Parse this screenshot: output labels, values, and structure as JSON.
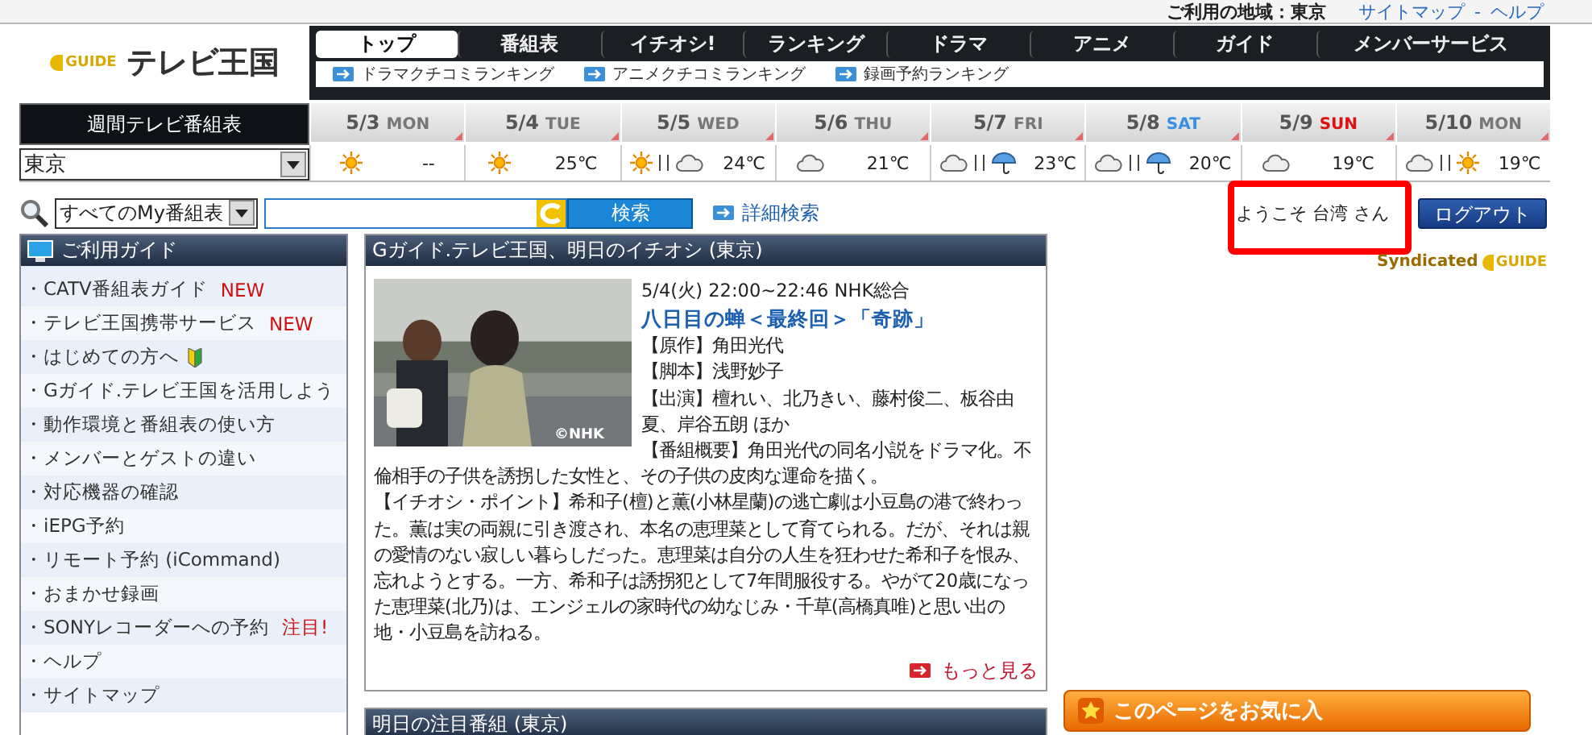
{
  "top_bar": {
    "region_label": "ご利用の地域：東京",
    "links": [
      "サイトマップ",
      "ヘルプ"
    ],
    "link_separator": "-"
  },
  "logo": {
    "badge": "GUIDE",
    "title": "テレビ王国"
  },
  "nav": {
    "tabs": [
      {
        "label": "トップ",
        "selected": true
      },
      {
        "label": "番組表",
        "selected": false
      },
      {
        "label": "イチオシ!",
        "selected": false
      },
      {
        "label": "ランキング",
        "selected": false
      },
      {
        "label": "ドラマ",
        "selected": false
      },
      {
        "label": "アニメ",
        "selected": false
      },
      {
        "label": "ガイド",
        "selected": false
      },
      {
        "label": "メンバーサービス",
        "selected": false
      }
    ],
    "sub_links": [
      "ドラマクチコミランキング",
      "アニメクチコミランキング",
      "録画予約ランキング"
    ]
  },
  "week": {
    "title": "週間テレビ番組表",
    "region": "東京",
    "days": [
      {
        "date": "5/3",
        "weekday": "MON",
        "color": "#777777",
        "weather": [
          {
            "kind": "sun"
          }
        ],
        "temp": "--"
      },
      {
        "date": "5/4",
        "weekday": "TUE",
        "color": "#777777",
        "weather": [
          {
            "kind": "sun"
          }
        ],
        "temp": "25℃"
      },
      {
        "date": "5/5",
        "weekday": "WED",
        "color": "#777777",
        "weather": [
          {
            "kind": "sun"
          },
          {
            "kind": "cloud"
          }
        ],
        "temp": "24℃"
      },
      {
        "date": "5/6",
        "weekday": "THU",
        "color": "#777777",
        "weather": [
          {
            "kind": "cloud"
          }
        ],
        "temp": "21℃"
      },
      {
        "date": "5/7",
        "weekday": "FRI",
        "color": "#777777",
        "weather": [
          {
            "kind": "cloud"
          },
          {
            "kind": "umbrella"
          }
        ],
        "temp": "23℃"
      },
      {
        "date": "5/8",
        "weekday": "SAT",
        "color": "#3a8ee6",
        "weather": [
          {
            "kind": "cloud"
          },
          {
            "kind": "umbrella"
          }
        ],
        "temp": "20℃"
      },
      {
        "date": "5/9",
        "weekday": "SUN",
        "color": "#dd1111",
        "weather": [
          {
            "kind": "cloud"
          }
        ],
        "temp": "19℃"
      },
      {
        "date": "5/10",
        "weekday": "MON",
        "color": "#777777",
        "weather": [
          {
            "kind": "cloud"
          },
          {
            "kind": "sun"
          }
        ],
        "temp": "19℃"
      }
    ]
  },
  "search": {
    "scope": "すべてのMy番組表",
    "button": "検索",
    "advanced_link": "詳細検索"
  },
  "welcome": {
    "greeting": "ようこそ 台湾 さん",
    "logout": "ログアウト",
    "syndicated": "Syndicated",
    "badge": "GUIDE"
  },
  "sidebar": {
    "title": "ご利用ガイド",
    "items": [
      {
        "label": "・CATV番組表ガイド",
        "kind": "badge",
        "badge": "NEW"
      },
      {
        "label": "・テレビ王国携帯サービス",
        "kind": "badge",
        "badge": "NEW"
      },
      {
        "label": "・はじめての方へ",
        "kind": "beginner"
      },
      {
        "label": "・Gガイド.テレビ王国を活用しよう",
        "kind": "plain"
      },
      {
        "label": "・動作環境と番組表の使い方",
        "kind": "plain"
      },
      {
        "label": "・メンバーとゲストの違い",
        "kind": "plain"
      },
      {
        "label": "・対応機器の確認",
        "kind": "plain"
      },
      {
        "label": "・iEPG予約",
        "kind": "plain"
      },
      {
        "label": "・リモート予約 (iCommand)",
        "kind": "plain"
      },
      {
        "label": "・おまかせ録画",
        "kind": "plain"
      },
      {
        "label": "・SONYレコーダーへの予約",
        "kind": "badge",
        "badge": "注目!"
      },
      {
        "label": "・ヘルプ",
        "kind": "plain"
      },
      {
        "label": "・サイトマップ",
        "kind": "plain"
      }
    ]
  },
  "feature": {
    "title": "Gガイド.テレビ王国、明日のイチオシ (東京)",
    "credit": "©NHK",
    "airtime": "5/4(火) 22:00~22:46 NHK総合",
    "program_title": "八日目の蝉＜最終回＞「奇跡」",
    "lines": [
      "【原作】角田光代",
      "【脚本】浅野妙子",
      "【出演】檀れい、北乃きい、藤村俊二、板谷由夏、岸谷五朗 ほか",
      "【番組概要】角田光代の同名小説をドラマ化。不倫相手の子供を誘拐した女性と、その子供の皮肉な運命を描く。",
      "【イチオシ・ポイント】希和子(檀)と薫(小林星蘭)の逃亡劇は小豆島の港で終わった。薫は実の両親に引き渡され、本名の恵理菜として育てられる。だが、それは親の愛情のない寂しい暮らしだった。恵理菜は自分の人生を狂わせた希和子を恨み、忘れようとする。一方、希和子は誘拐犯として7年間服役する。やがて20歳になった恵理菜(北乃)は、エンジェルの家時代の幼なじみ・千草(高橋真唯)と思い出の地・小豆島を訪ねる。"
    ],
    "more_link": "もっと見る"
  },
  "next_panel": {
    "title": "明日の注目番組 (東京)"
  },
  "favorite_button": "このページをお気に入"
}
